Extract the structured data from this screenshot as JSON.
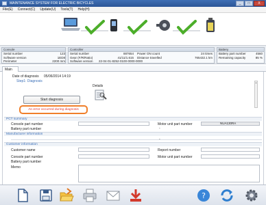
{
  "window": {
    "title": "MAINTENANCE SYSTEM FOR ELECTRIC BICYCLES"
  },
  "window_controls": {
    "minimize": "_",
    "maximize": "□",
    "close": "X"
  },
  "menu": {
    "items": [
      {
        "label": "File(E)"
      },
      {
        "label": "Connect(C)"
      },
      {
        "label": "Update(U)"
      },
      {
        "label": "Tools(T)"
      },
      {
        "label": "Help(H)"
      }
    ]
  },
  "info": {
    "console": {
      "header": "Console",
      "rows": [
        {
          "label": "Serial number",
          "value": "123"
        },
        {
          "label": "Software version",
          "value": "1ED8"
        },
        {
          "label": "Perimeter",
          "value": "2200 mm"
        }
      ]
    },
    "controller": {
      "header": "Controller",
      "rows": [
        {
          "label": "Serial number",
          "value": "887654",
          "label2": "Power ON count",
          "value2": "24 times"
        },
        {
          "label": "Gear (F/R/Ratio)",
          "value": "41/11/1.615",
          "label2": "Distance travelled",
          "value2": "765432.1 km"
        },
        {
          "label": "Software version",
          "value": "22-04-01-8252-0100-0000-0000",
          "label2": "",
          "value2": ""
        }
      ]
    },
    "battery": {
      "header": "Battery",
      "rows": [
        {
          "label": "Battery part number",
          "value": "4560"
        },
        {
          "label": "Remaining capacity",
          "value": "85 %"
        }
      ]
    }
  },
  "tabs": [
    {
      "label": "Main"
    }
  ],
  "main": {
    "date_label": "Date of diagnosis",
    "date_value": "05/06/2014 14:19",
    "step_label": "Step1: Diagnosis",
    "details_label": "Details",
    "start_button": "Start diagnosis",
    "error_message": "An error occurred during diagnosis",
    "sections": {
      "pct": "PCT summary",
      "manufacturer": "Manufacturer information",
      "customer": "Customer information"
    },
    "fields": {
      "console_part": "Console part number",
      "battery_part": "Battery part number",
      "motor_part": "Motor unit part number",
      "motor_part_value": "NUA130RA",
      "battery_dash": "-",
      "manufacturer_dash": "-",
      "customer_name": "Customer name",
      "report_number": "Report number",
      "console_part2": "Console part number",
      "battery_part2": "Battery part number",
      "motor_part2": "Motor unit part number",
      "memo": "Memo"
    }
  },
  "toolbar": {
    "buttons": [
      {
        "icon": "new-document-icon"
      },
      {
        "icon": "save-icon"
      },
      {
        "icon": "open-folder-icon"
      },
      {
        "icon": "print-icon"
      },
      {
        "icon": "email-icon"
      },
      {
        "icon": "export-pdf-icon"
      },
      {
        "icon": "help-icon"
      },
      {
        "icon": "refresh-icon"
      },
      {
        "icon": "settings-icon"
      }
    ]
  },
  "colors": {
    "title_bar": "#2b5596",
    "accent_blue": "#3b6fb8",
    "check_green": "#4cae2a",
    "error_red": "#e3322b",
    "error_border": "#f07f2a"
  }
}
